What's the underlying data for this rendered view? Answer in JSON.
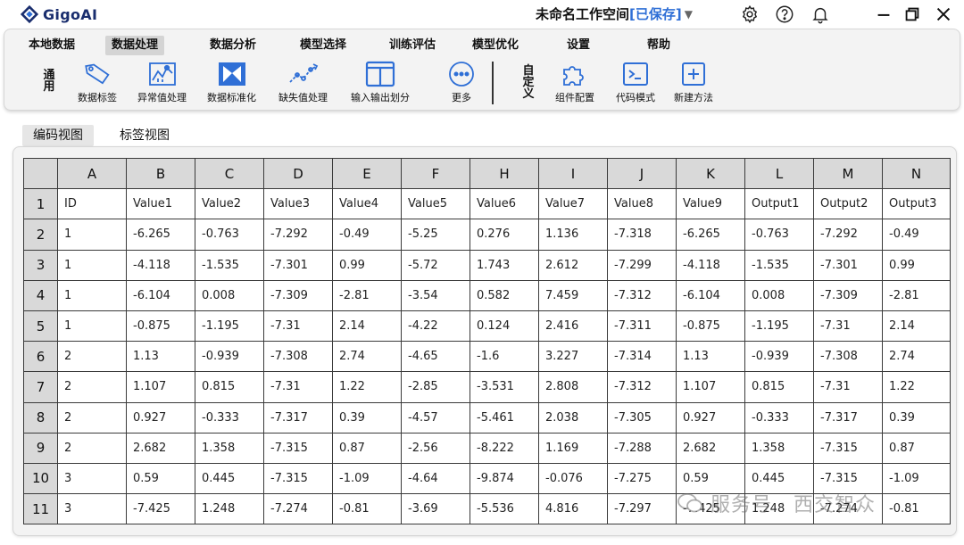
{
  "app": {
    "logo_text": "GigoAI",
    "workspace_name": "未命名工作空间",
    "workspace_status": "[已保存]",
    "workspace_caret": "▼"
  },
  "titlebar_icons": [
    "gear-icon",
    "help-icon",
    "bell-icon",
    "minimize-icon",
    "maximize-icon",
    "close-icon"
  ],
  "menu": {
    "items": [
      "本地数据",
      "数据处理",
      "数据分析",
      "模型选择",
      "训练评估",
      "模型优化",
      "设置",
      "帮助"
    ],
    "active": "数据处理"
  },
  "ribbon": {
    "general_label": "通用",
    "custom_label": "自定义",
    "general_tools": [
      {
        "label": "数据标签",
        "icon": "tag-icon"
      },
      {
        "label": "异常值处理",
        "icon": "anomaly-chart-icon"
      },
      {
        "label": "数据标准化",
        "icon": "normalize-icon"
      },
      {
        "label": "缺失值处理",
        "icon": "missing-value-icon"
      },
      {
        "label": "输入输出划分",
        "icon": "split-panel-icon"
      },
      {
        "label": "更多",
        "icon": "more-icon"
      }
    ],
    "custom_tools": [
      {
        "label": "组件配置",
        "icon": "puzzle-icon"
      },
      {
        "label": "代码模式",
        "icon": "terminal-icon"
      },
      {
        "label": "新建方法",
        "icon": "add-square-icon"
      }
    ]
  },
  "view_tabs": {
    "items": [
      "编码视图",
      "标签视图"
    ],
    "active": "编码视图"
  },
  "table": {
    "columns": [
      "A",
      "B",
      "C",
      "D",
      "E",
      "F",
      "H",
      "I",
      "J",
      "K",
      "L",
      "M",
      "N"
    ],
    "rows": [
      {
        "num": "1",
        "cells": [
          "ID",
          "Value1",
          "Value2",
          "Value3",
          "Value4",
          "Value5",
          "Value6",
          "Value7",
          "Value8",
          "Value9",
          "Output1",
          "Output2",
          "Output3"
        ]
      },
      {
        "num": "2",
        "cells": [
          "1",
          "-6.265",
          "-0.763",
          "-7.292",
          "-0.49",
          "-5.25",
          "0.276",
          "1.136",
          "-7.318",
          "-6.265",
          "-0.763",
          "-7.292",
          "-0.49"
        ]
      },
      {
        "num": "3",
        "cells": [
          "1",
          "-4.118",
          "-1.535",
          "-7.301",
          "0.99",
          "-5.72",
          "1.743",
          "2.612",
          "-7.299",
          "-4.118",
          "-1.535",
          "-7.301",
          "0.99"
        ]
      },
      {
        "num": "4",
        "cells": [
          "1",
          "-6.104",
          "0.008",
          "-7.309",
          "-2.81",
          "-3.54",
          "0.582",
          "7.459",
          "-7.312",
          "-6.104",
          "0.008",
          "-7.309",
          "-2.81"
        ]
      },
      {
        "num": "5",
        "cells": [
          "1",
          "-0.875",
          "-1.195",
          "-7.31",
          "2.14",
          "-4.22",
          "0.124",
          "2.416",
          "-7.311",
          "-0.875",
          "-1.195",
          "-7.31",
          "2.14"
        ]
      },
      {
        "num": "6",
        "cells": [
          "2",
          "1.13",
          "-0.939",
          "-7.308",
          "2.74",
          "-4.65",
          "-1.6",
          "3.227",
          "-7.314",
          "1.13",
          "-0.939",
          "-7.308",
          "2.74"
        ]
      },
      {
        "num": "7",
        "cells": [
          "2",
          "1.107",
          "0.815",
          "-7.31",
          "1.22",
          "-2.85",
          "-3.531",
          "2.808",
          "-7.312",
          "1.107",
          "0.815",
          "-7.31",
          "1.22"
        ]
      },
      {
        "num": "8",
        "cells": [
          "2",
          "0.927",
          "-0.333",
          "-7.317",
          "0.39",
          "-4.57",
          "-5.461",
          "2.038",
          "-7.305",
          "0.927",
          "-0.333",
          "-7.317",
          "0.39"
        ]
      },
      {
        "num": "9",
        "cells": [
          "2",
          "2.682",
          "1.358",
          "-7.315",
          "0.87",
          "-2.56",
          "-8.222",
          "1.169",
          "-7.288",
          "2.682",
          "1.358",
          "-7.315",
          "0.87"
        ]
      },
      {
        "num": "10",
        "cells": [
          "3",
          "0.59",
          "0.445",
          "-7.315",
          "-1.09",
          "-4.64",
          "-9.874",
          "-0.076",
          "-7.275",
          "0.59",
          "0.445",
          "-7.315",
          "-1.09"
        ]
      },
      {
        "num": "11",
        "cells": [
          "3",
          "-7.425",
          "1.248",
          "-7.274",
          "-0.81",
          "-3.69",
          "-5.536",
          "4.816",
          "-7.297",
          "-7.425",
          "1.248",
          "-7.274",
          "-0.81"
        ]
      }
    ]
  },
  "watermark": "服务号 · 西交智众",
  "colors": {
    "brand_dark": "#1a2e6e",
    "brand_blue": "#2f6fd6",
    "icon_blue": "#2f6fd6",
    "ribbon_bg": "#f3f3f3",
    "header_bg": "#d9d9d9"
  }
}
